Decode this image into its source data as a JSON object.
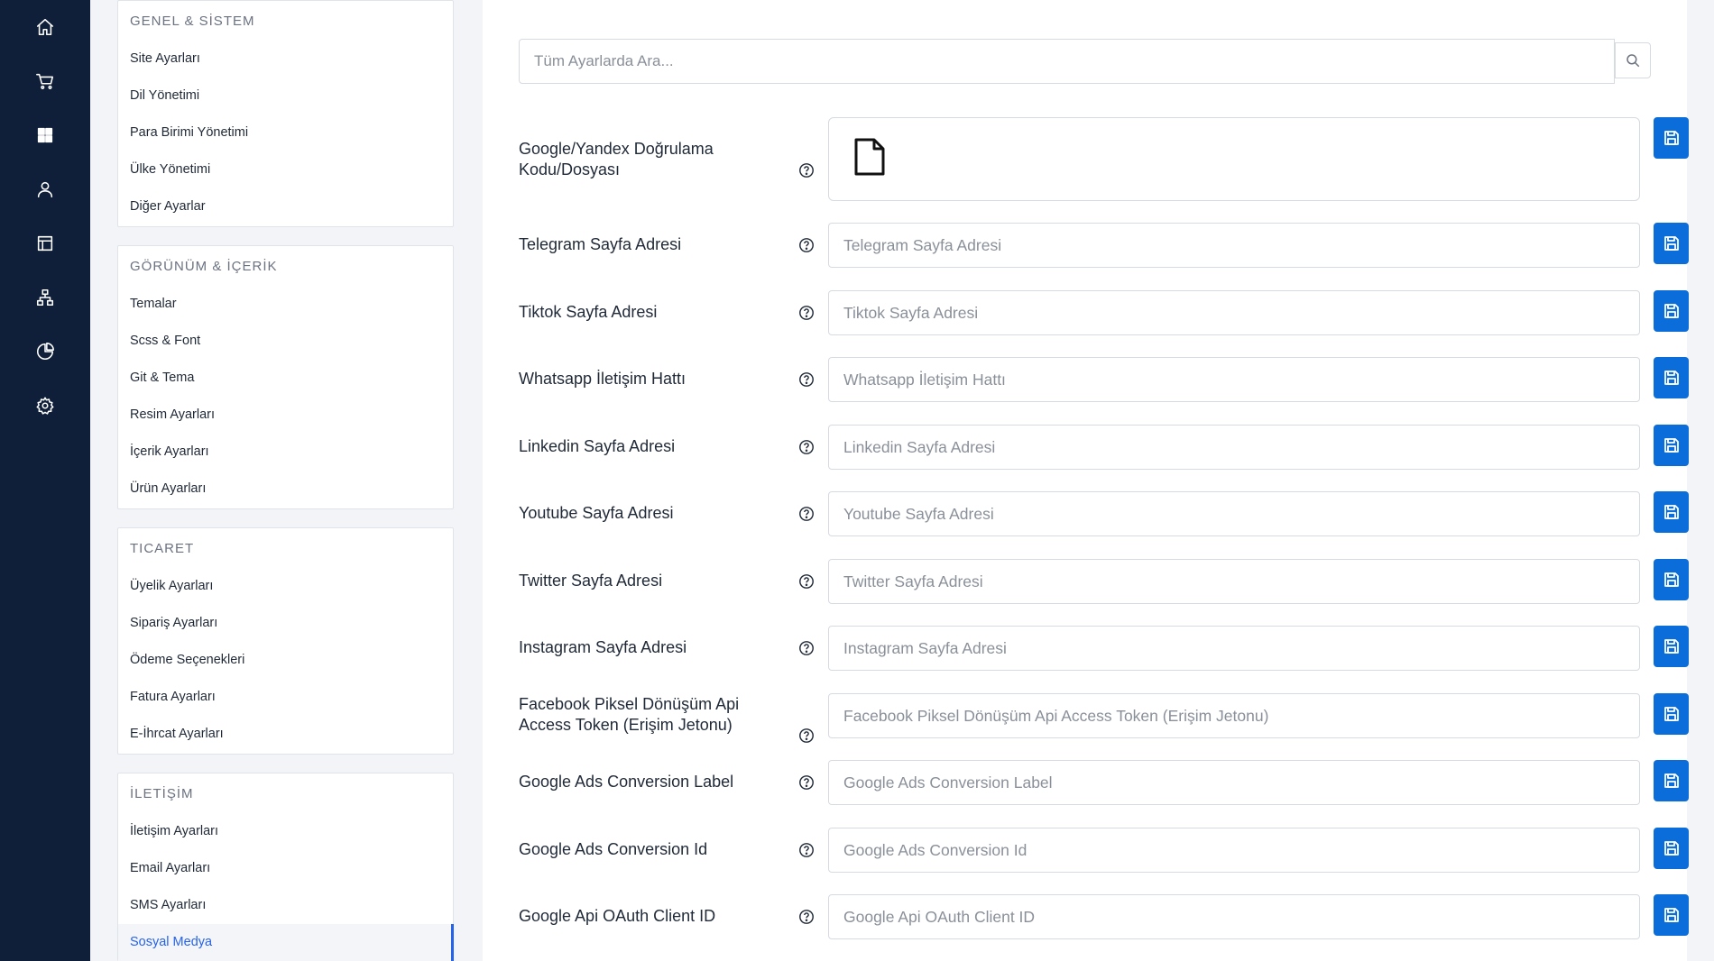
{
  "rail": {
    "icons": [
      "home-icon",
      "cart-icon",
      "grid-icon",
      "user-icon",
      "layout-icon",
      "sitemap-icon",
      "pie-chart-icon",
      "gear-icon"
    ],
    "active": "gear-icon"
  },
  "menu": {
    "groups": [
      {
        "title": "GENEL & SİSTEM",
        "items": [
          "Site Ayarları",
          "Dil Yönetimi",
          "Para Birimi Yönetimi",
          "Ülke Yönetimi",
          "Diğer Ayarlar"
        ]
      },
      {
        "title": "GÖRÜNÜM & İÇERİK",
        "items": [
          "Temalar",
          "Scss & Font",
          "Git & Tema",
          "Resim Ayarları",
          "İçerik Ayarları",
          "Ürün Ayarları"
        ]
      },
      {
        "title": "TICARET",
        "items": [
          "Üyelik Ayarları",
          "Sipariş Ayarları",
          "Ödeme Seçenekleri",
          "Fatura Ayarları",
          "E-İhrcat Ayarları"
        ]
      },
      {
        "title": "İLETİŞİM",
        "items": [
          "İletişim Ayarları",
          "Email Ayarları",
          "SMS Ayarları",
          "Sosyal Medya"
        ]
      }
    ],
    "active_item": "Sosyal Medya"
  },
  "search": {
    "placeholder": "Tüm Ayarlarda Ara..."
  },
  "settings": {
    "file_field": {
      "label": "Google/Yandex Doğrulama Kodu/Dosyası"
    },
    "fields": [
      {
        "label": "Telegram Sayfa Adresi",
        "placeholder": "Telegram Sayfa Adresi"
      },
      {
        "label": "Tiktok Sayfa Adresi",
        "placeholder": "Tiktok Sayfa Adresi"
      },
      {
        "label": "Whatsapp İletişim Hattı",
        "placeholder": "Whatsapp İletişim Hattı"
      },
      {
        "label": "Linkedin Sayfa Adresi",
        "placeholder": "Linkedin Sayfa Adresi"
      },
      {
        "label": "Youtube Sayfa Adresi",
        "placeholder": "Youtube Sayfa Adresi"
      },
      {
        "label": "Twitter Sayfa Adresi",
        "placeholder": "Twitter Sayfa Adresi"
      },
      {
        "label": "Instagram Sayfa Adresi",
        "placeholder": "Instagram Sayfa Adresi"
      },
      {
        "label": "Facebook Piksel Dönüşüm Api Access Token (Erişim Jetonu)",
        "placeholder": "Facebook Piksel Dönüşüm Api Access Token (Erişim Jetonu)"
      },
      {
        "label": "Google Ads Conversion Label",
        "placeholder": "Google Ads Conversion Label"
      },
      {
        "label": "Google Ads Conversion Id",
        "placeholder": "Google Ads Conversion Id"
      },
      {
        "label": "Google Api OAuth Client ID",
        "placeholder": "Google Api OAuth Client ID"
      }
    ]
  },
  "colors": {
    "rail_bg": "#0f1f3a",
    "accent": "#0a6dd9",
    "active_link": "#2563eb"
  }
}
